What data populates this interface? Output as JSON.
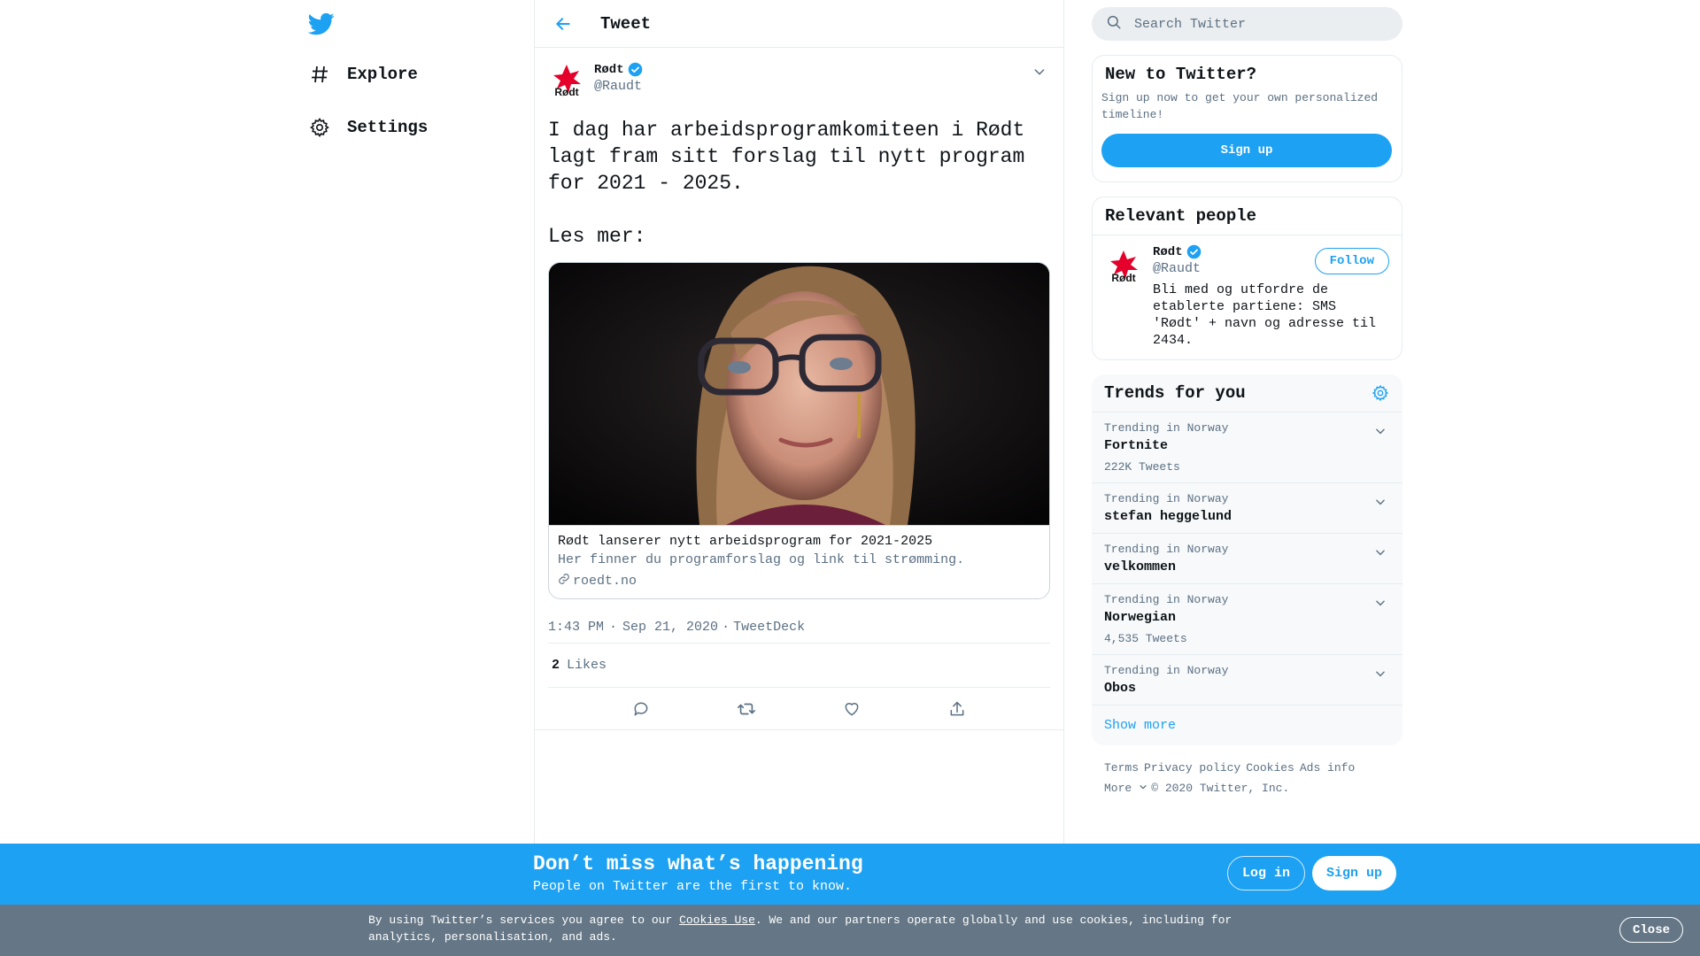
{
  "colors": {
    "brand": "#1da1f2",
    "text": "#0f1419",
    "muted": "#5b7083",
    "border": "#e6ecf0",
    "cookie_bg": "#657786"
  },
  "nav": {
    "items": [
      {
        "label": "Explore",
        "icon": "hashtag-icon"
      },
      {
        "label": "Settings",
        "icon": "gear-icon"
      }
    ]
  },
  "header": {
    "title": "Tweet"
  },
  "tweet": {
    "author_name": "Rødt",
    "author_handle": "@Raudt",
    "text": "I dag har arbeidsprogramkomiteen i Rødt\nlagt fram sitt forslag til nytt program\nfor 2021 - 2025.\n\nLes mer:",
    "card": {
      "title": "Rødt lanserer nytt arbeidsprogram for 2021-2025",
      "description": "Her finner du programforslag og link til strømming.",
      "domain": "roedt.no"
    },
    "time": "1:43 PM",
    "date": "Sep 21, 2020",
    "source": "TweetDeck",
    "likes_count": "2",
    "likes_label": "Likes"
  },
  "search": {
    "placeholder": "Search Twitter"
  },
  "signup_box": {
    "title": "New to Twitter?",
    "description": "Sign up now to get your own personalized timeline!",
    "button": "Sign up"
  },
  "relevant_people": {
    "title": "Relevant people",
    "person": {
      "name": "Rødt",
      "handle": "@Raudt",
      "bio": "Bli med og utfordre de etablerte partiene: SMS 'Rødt' + navn og adresse til 2434.",
      "follow_label": "Follow"
    }
  },
  "trends": {
    "title": "Trends for you",
    "items": [
      {
        "context": "Trending in Norway",
        "name": "Fortnite",
        "count": "222K Tweets"
      },
      {
        "context": "Trending in Norway",
        "name": "stefan heggelund",
        "count": ""
      },
      {
        "context": "Trending in Norway",
        "name": "velkommen",
        "count": ""
      },
      {
        "context": "Trending in Norway",
        "name": "Norwegian",
        "count": "4,535 Tweets"
      },
      {
        "context": "Trending in Norway",
        "name": "Obos",
        "count": ""
      }
    ],
    "show_more": "Show more"
  },
  "footer": {
    "links": [
      "Terms",
      "Privacy policy",
      "Cookies",
      "Ads info"
    ],
    "more": "More",
    "copyright": "© 2020 Twitter, Inc."
  },
  "bottom_bar": {
    "title": "Don’t miss what’s happening",
    "subtitle": "People on Twitter are the first to know.",
    "login": "Log in",
    "signup": "Sign up"
  },
  "cookie_bar": {
    "text_before": "By using Twitter’s services you agree to our ",
    "link": "Cookies Use",
    "text_after": ". We and our partners operate globally and use cookies, including for analytics, personalisation, and ads.",
    "close": "Close"
  }
}
